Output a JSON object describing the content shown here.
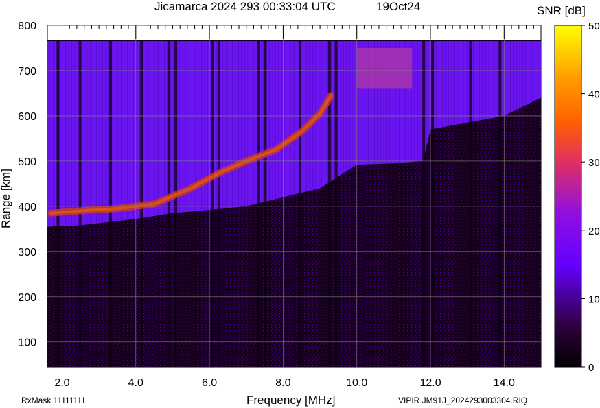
{
  "header": {
    "title": "Jicamarca 2024 293 00:33:04 UTC",
    "date": "19Oct24",
    "colorbar_label": "SNR [dB]"
  },
  "footer": {
    "rx_mask": "RxMask 11111111",
    "file_label": "VIPIR  JM91J_2024293003304.RIQ"
  },
  "chart_data": {
    "type": "heatmap",
    "title": "Jicamarca 2024 293 00:33:04 UTC",
    "xlabel": "Frequency [MHz]",
    "ylabel": "Range [km]",
    "xlim": [
      1.6,
      15.0
    ],
    "ylim": [
      45,
      800
    ],
    "x_ticks": [
      "2.0",
      "4.0",
      "6.0",
      "8.0",
      "10.0",
      "12.0",
      "14.0"
    ],
    "x_tick_values": [
      2,
      4,
      6,
      8,
      10,
      12,
      14
    ],
    "y_ticks": [
      "800",
      "700",
      "600",
      "500",
      "400",
      "300",
      "200",
      "100"
    ],
    "y_tick_values": [
      800,
      700,
      600,
      500,
      400,
      300,
      200,
      100
    ],
    "grid": true,
    "colorbar": {
      "label": "SNR [dB]",
      "range": [
        0,
        50
      ],
      "ticks": [
        "50",
        "40",
        "30",
        "20",
        "10",
        "0"
      ],
      "tick_values": [
        50,
        40,
        30,
        20,
        10,
        0
      ],
      "colormap": [
        "#000000",
        "#3a0060",
        "#6a00ff",
        "#c020a0",
        "#ff6000",
        "#ffff00"
      ]
    },
    "data_upper_range_km": 765,
    "lower_boundary": {
      "frequency_mhz": [
        1.6,
        2.5,
        4.0,
        5.0,
        6.0,
        7.0,
        8.0,
        9.0,
        10.0,
        11.0,
        11.8,
        12.0,
        13.0,
        14.0,
        15.0
      ],
      "range_km": [
        355,
        358,
        372,
        385,
        392,
        400,
        420,
        440,
        492,
        495,
        500,
        570,
        585,
        600,
        640
      ]
    },
    "echo_trace": {
      "frequency_mhz": [
        1.7,
        2.5,
        3.5,
        4.5,
        5.5,
        6.3,
        7.0,
        7.8,
        8.5,
        9.0,
        9.3
      ],
      "range_km": [
        385,
        390,
        395,
        405,
        440,
        475,
        500,
        525,
        565,
        605,
        645
      ],
      "peak_snr_db": 30
    },
    "upper_echo": {
      "frequency_mhz": [
        10.0,
        11.5
      ],
      "range_km": [
        660,
        750
      ],
      "peak_snr_db": 28
    }
  }
}
